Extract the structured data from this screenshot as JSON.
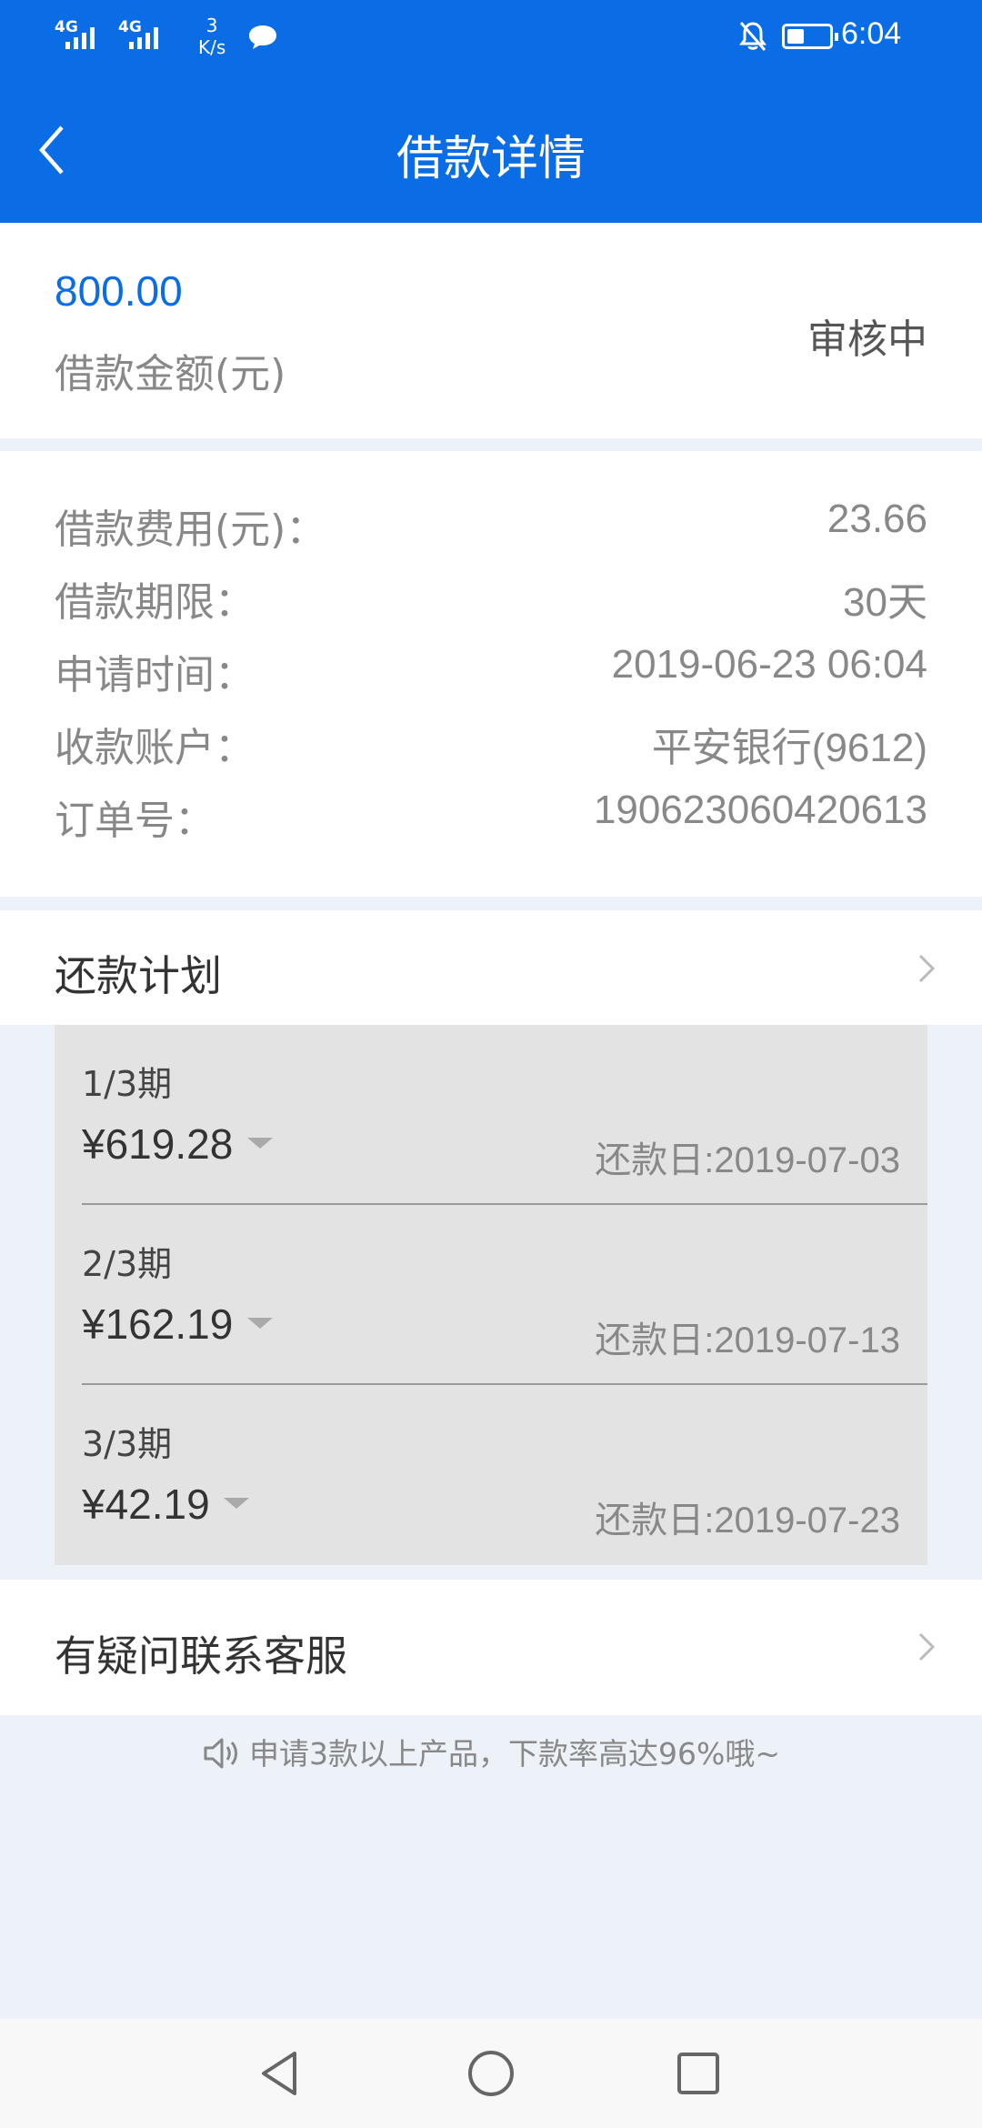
{
  "status_bar": {
    "signal1": "4G",
    "signal2": "4G",
    "speed_value": "3",
    "speed_unit": "K/s",
    "time": "6:04"
  },
  "header": {
    "title": "借款详情"
  },
  "loan": {
    "amount": "800.00",
    "amount_label": "借款金额(元)",
    "status": "审核中"
  },
  "details": [
    {
      "label": "借款费用(元)：",
      "value": "23.66"
    },
    {
      "label": "借款期限：",
      "value": "30天"
    },
    {
      "label": "申请时间：",
      "value": "2019-06-23 06:04"
    },
    {
      "label": "收款账户：",
      "value": "平安银行(9612)"
    },
    {
      "label": "订单号：",
      "value": "190623060420613"
    }
  ],
  "plan": {
    "title": "还款计划",
    "installments": [
      {
        "period": "1/3期",
        "amount": "¥619.28",
        "due": "还款日:2019-07-03"
      },
      {
        "period": "2/3期",
        "amount": "¥162.19",
        "due": "还款日:2019-07-13"
      },
      {
        "period": "3/3期",
        "amount": "¥42.19",
        "due": "还款日:2019-07-23"
      }
    ]
  },
  "contact": {
    "label": "有疑问联系客服"
  },
  "notice": "申请3款以上产品，下款率高达96%哦~"
}
